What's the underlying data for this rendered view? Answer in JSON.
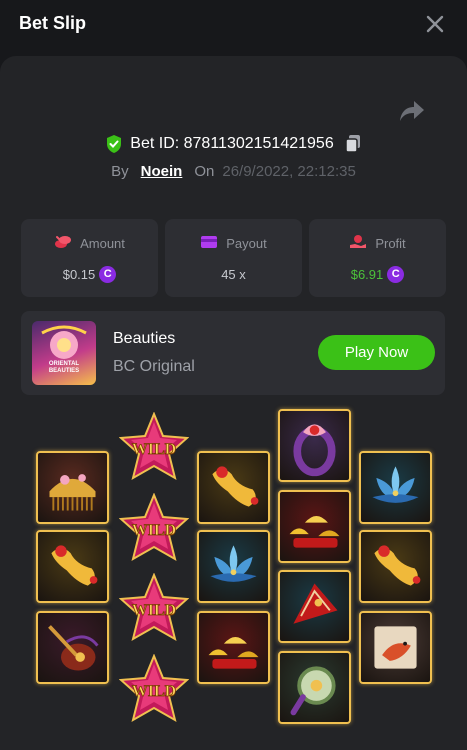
{
  "header": {
    "title": "Bet Slip"
  },
  "bet": {
    "id_text": "Bet ID: 87811302151421956",
    "by_label": "By",
    "username": "Noein",
    "on_label": "On",
    "date": "26/9/2022, 22:12:35"
  },
  "stats": [
    {
      "label": "Amount",
      "value": "$0.15",
      "icon": "coins-icon",
      "has_coin": true
    },
    {
      "label": "Payout",
      "value": "45 x",
      "icon": "card-icon",
      "has_coin": false
    },
    {
      "label": "Profit",
      "value": "$6.91",
      "icon": "hand-coin-icon",
      "has_coin": true
    }
  ],
  "coin_symbol": "C",
  "game": {
    "name": "Beauties",
    "provider": "BC Original",
    "play_label": "Play Now",
    "thumb_text": "ORIENTAL BEAUTIES"
  },
  "reels": [
    [
      "comb",
      "jade-hairpin",
      "pipa"
    ],
    [
      "wild",
      "wild",
      "wild",
      "wild"
    ],
    [
      "jade-hairpin",
      "lotus",
      "gold-ingots"
    ],
    [
      "jade-ring",
      "gold-ingots",
      "red-fan",
      "mirror"
    ],
    [
      "lotus",
      "jade-hairpin",
      "koi-scroll"
    ]
  ],
  "wild_label": "WILD",
  "colors": {
    "accent_green": "#3bc117",
    "profit_green": "#4cc23a",
    "coin_purple": "#8a2be2",
    "frame_gold": "#f0c050"
  }
}
